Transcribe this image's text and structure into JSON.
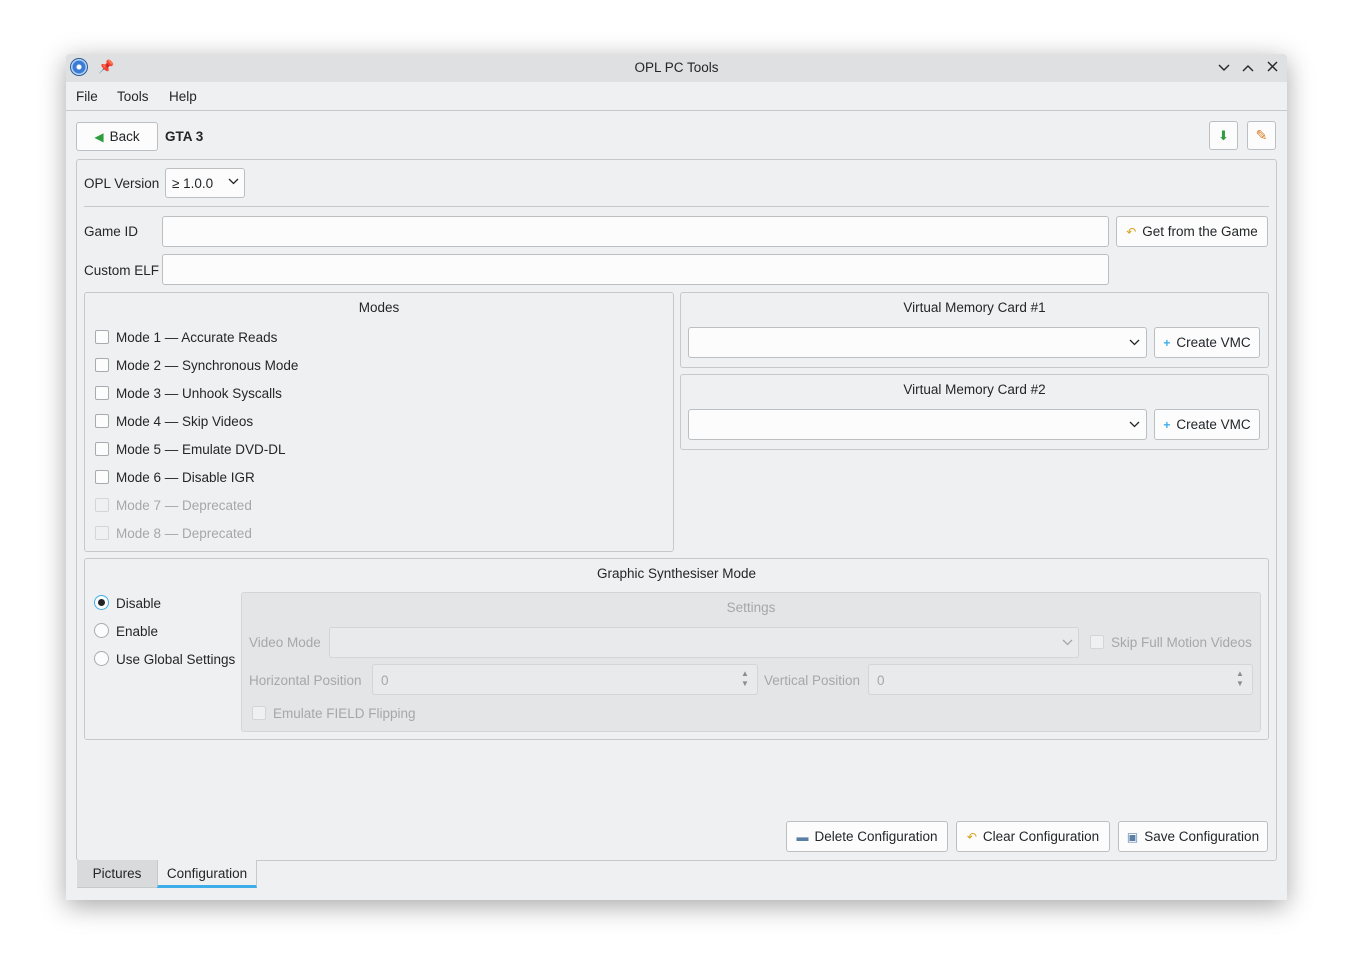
{
  "window": {
    "title": "OPL PC Tools",
    "icons": [
      "app-disc-icon",
      "pin-icon",
      "minimize-icon",
      "maximize-icon",
      "close-icon"
    ]
  },
  "menu": {
    "file": "File",
    "tools": "Tools",
    "help": "Help"
  },
  "header": {
    "back_label": "Back",
    "game_title": "GTA 3",
    "icons": [
      "back-arrow-icon",
      "download-icon",
      "edit-icon"
    ]
  },
  "opl": {
    "label": "OPL Version",
    "value": "≥ 1.0.0"
  },
  "game_id": {
    "label": "Game ID",
    "value": "",
    "button": "Get from the Game"
  },
  "custom_elf": {
    "label": "Custom ELF",
    "value": ""
  },
  "modes": {
    "title": "Modes",
    "items": [
      {
        "label": "Mode 1 — Accurate Reads",
        "checked": false,
        "enabled": true
      },
      {
        "label": "Mode 2 — Synchronous Mode",
        "checked": false,
        "enabled": true
      },
      {
        "label": "Mode 3 — Unhook Syscalls",
        "checked": false,
        "enabled": true
      },
      {
        "label": "Mode 4 — Skip Videos",
        "checked": false,
        "enabled": true
      },
      {
        "label": "Mode 5 — Emulate DVD-DL",
        "checked": false,
        "enabled": true
      },
      {
        "label": "Mode 6 — Disable IGR",
        "checked": false,
        "enabled": true
      },
      {
        "label": "Mode 7 — Deprecated",
        "checked": false,
        "enabled": false
      },
      {
        "label": "Mode 8 — Deprecated",
        "checked": false,
        "enabled": false
      }
    ]
  },
  "vmc1": {
    "title": "Virtual Memory Card #1",
    "value": "",
    "button": "Create VMC"
  },
  "vmc2": {
    "title": "Virtual Memory Card #2",
    "value": "",
    "button": "Create VMC"
  },
  "gsm": {
    "title": "Graphic Synthesiser Mode",
    "options": [
      "Disable",
      "Enable",
      "Use Global Settings"
    ],
    "selected": "Disable",
    "settings": {
      "title": "Settings",
      "video_mode_label": "Video Mode",
      "video_mode_value": "",
      "skip_fmv_label": "Skip Full Motion Videos",
      "hpos_label": "Horizontal Position",
      "hpos_value": "0",
      "vpos_label": "Vertical Position",
      "vpos_value": "0",
      "field_flip_label": "Emulate FIELD Flipping"
    }
  },
  "actions": {
    "delete": "Delete Configuration",
    "clear": "Clear Configuration",
    "save": "Save Configuration"
  },
  "tabs": {
    "pictures": "Pictures",
    "configuration": "Configuration",
    "active": "Configuration"
  },
  "colors": {
    "accent": "#3daee9",
    "window_bg": "#eff0f1",
    "titlebar_bg": "#dee0e2"
  }
}
